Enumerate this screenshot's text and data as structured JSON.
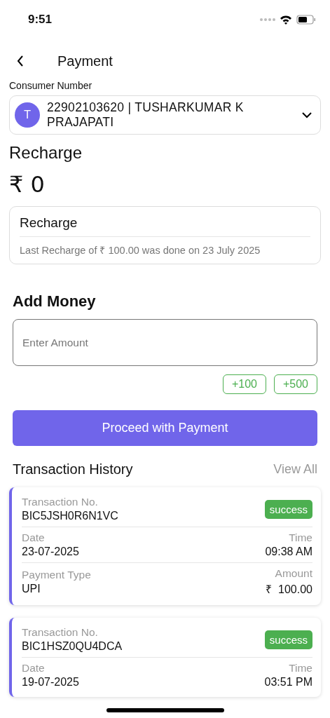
{
  "status_bar": {
    "time": "9:51"
  },
  "header": {
    "title": "Payment"
  },
  "consumer": {
    "label": "Consumer Number",
    "avatar_initial": "T",
    "value": "22902103620 | TUSHARKUMAR K PRAJAPATI"
  },
  "recharge": {
    "heading": "Recharge",
    "balance": "₹ 0",
    "card_title": "Recharge",
    "last_recharge": "Last Recharge of ₹ 100.00 was done on 23 July 2025"
  },
  "add_money": {
    "heading": "Add Money",
    "placeholder": "Enter Amount",
    "quick_amounts": [
      "+100",
      "+500"
    ],
    "proceed_button": "Proceed with Payment"
  },
  "transactions": {
    "heading": "Transaction History",
    "view_all": "View All",
    "items": [
      {
        "no_label": "Transaction No.",
        "no": "BIC5JSH0R6N1VC",
        "status": "success",
        "date_label": "Date",
        "date": "23-07-2025",
        "time_label": "Time",
        "time": "09:38 AM",
        "type_label": "Payment Type",
        "type": "UPI",
        "amount_label": "Amount",
        "amount": "₹  100.00"
      },
      {
        "no_label": "Transaction No.",
        "no": "BIC1HSZ0QU4DCA",
        "status": "success",
        "date_label": "Date",
        "date": "19-07-2025",
        "time_label": "Time",
        "time": "03:51 PM"
      }
    ]
  }
}
